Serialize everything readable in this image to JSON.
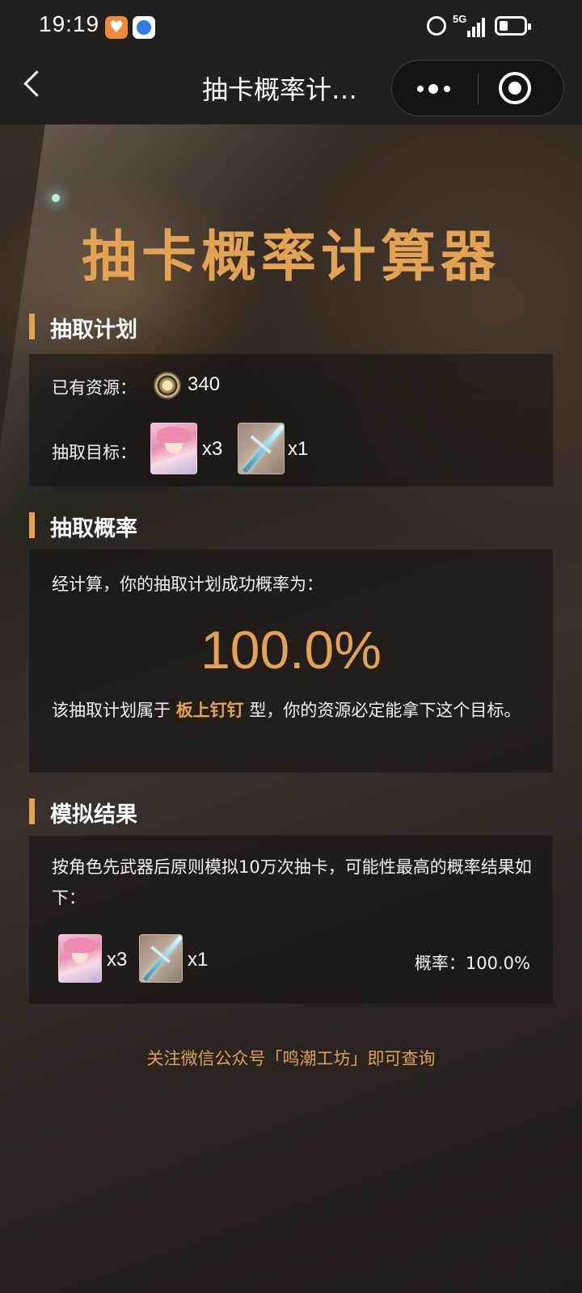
{
  "status_bar": {
    "time": "19:19",
    "network": "5G"
  },
  "nav": {
    "title": "抽卡概率计…"
  },
  "page": {
    "title": "抽卡概率计算器"
  },
  "plan": {
    "heading": "抽取计划",
    "resource_label": "已有资源：",
    "resource_value": "340",
    "target_label": "抽取目标：",
    "targets": [
      {
        "type": "character",
        "count": "x3"
      },
      {
        "type": "weapon",
        "count": "x1"
      }
    ]
  },
  "probability": {
    "heading": "抽取概率",
    "intro": "经计算，你的抽取计划成功概率为：",
    "value": "100.0%",
    "verdict_prefix": "该抽取计划属于 ",
    "verdict_type": "板上钉钉",
    "verdict_suffix": " 型，你的资源必定能拿下这个目标。"
  },
  "simulation": {
    "heading": "模拟结果",
    "description": "按角色先武器后原则模拟10万次抽卡，可能性最高的概率结果如下：",
    "results": [
      {
        "type": "character",
        "count": "x3"
      },
      {
        "type": "weapon",
        "count": "x1"
      }
    ],
    "prob_text": "概率：100.0%"
  },
  "footer": {
    "text": "关注微信公众号「鸣潮工坊」即可查询"
  },
  "colors": {
    "accent": "#e4a253",
    "background": "#2b2420",
    "bar": "#231f1c"
  }
}
